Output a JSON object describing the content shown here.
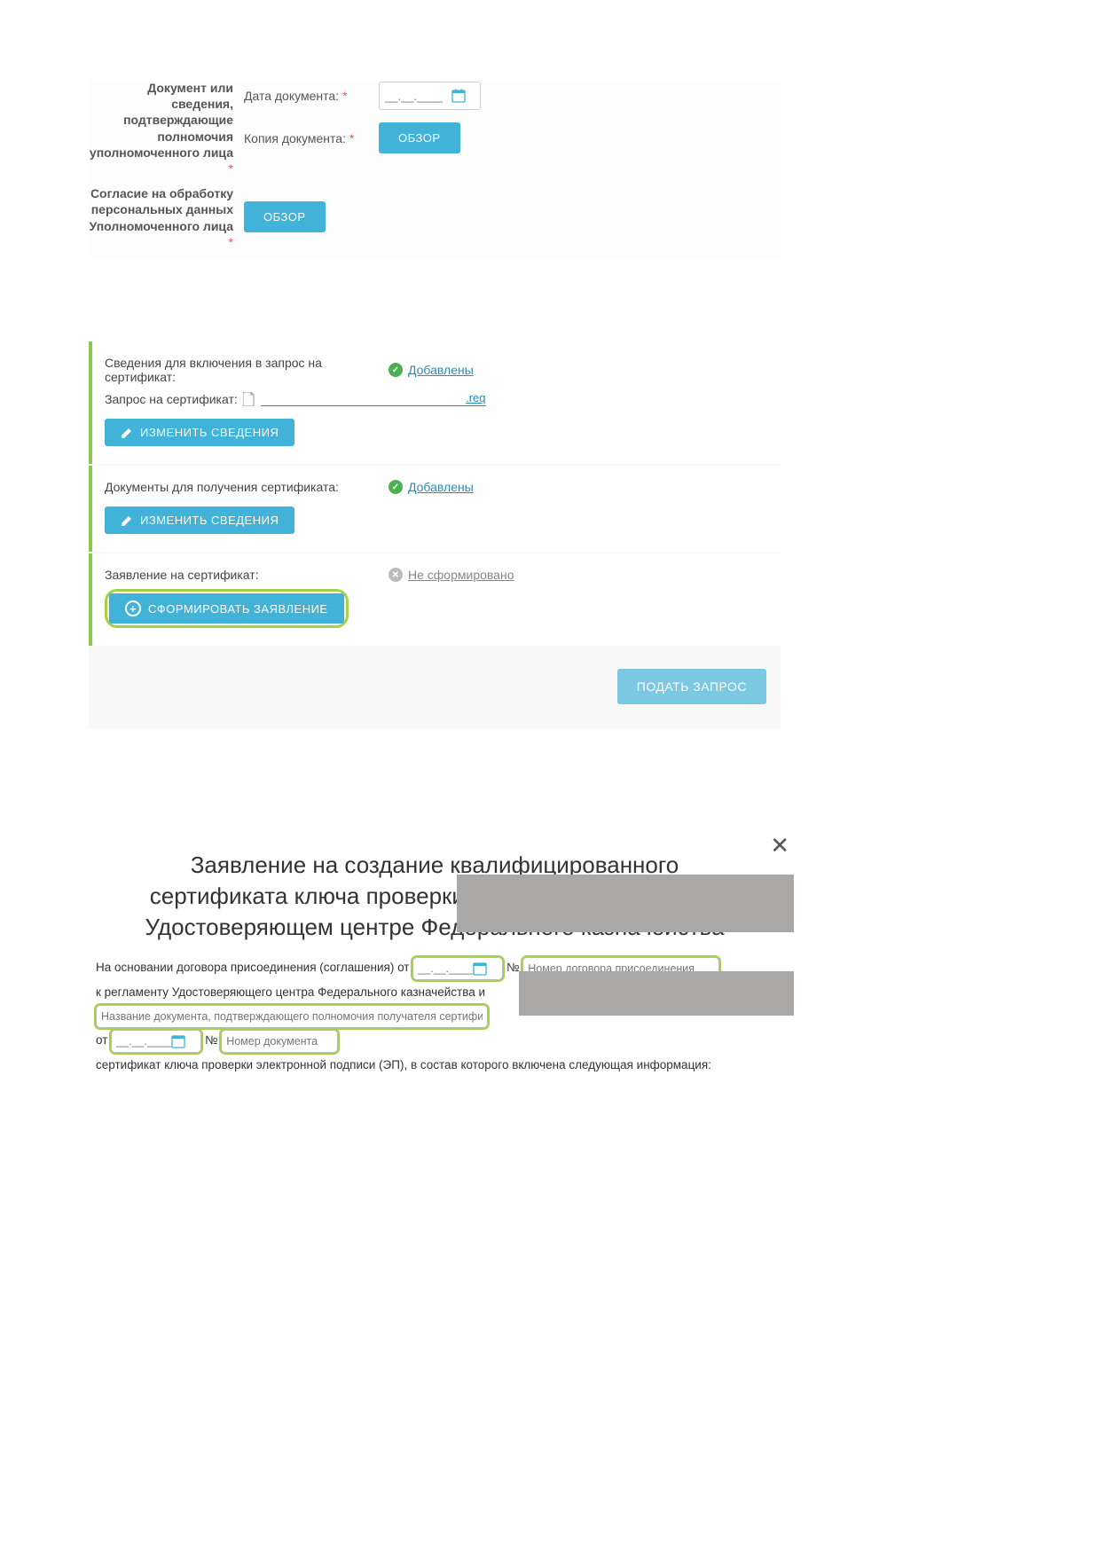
{
  "section1": {
    "row1_label": "Документ или сведения, подтверждающие полномочия уполномоченного лица",
    "date_label": "Дата документа:",
    "date_placeholder": "__.__.____",
    "copy_label": "Копия документа:",
    "browse": "ОБЗОР",
    "row2_label": "Согласие на обработку персональных данных Уполномоченного лица"
  },
  "section2": {
    "card1": {
      "label": "Сведения для включения в запрос на сертификат:",
      "status": "Добавлены",
      "req_label": "Запрос на сертификат:",
      "file_ext": ".req",
      "btn": "ИЗМЕНИТЬ СВЕДЕНИЯ"
    },
    "card2": {
      "label": "Документы для получения сертификата:",
      "status": "Добавлены",
      "btn": "ИЗМЕНИТЬ СВЕДЕНИЯ"
    },
    "card3": {
      "label": "Заявление на сертификат:",
      "status": "Не сформировано",
      "btn": "СФОРМИРОВАТЬ ЗАЯВЛЕНИЕ"
    },
    "submit": "ПОДАТЬ ЗАПРОС"
  },
  "section3": {
    "title": "Заявление на создание квалифицированного сертификата ключа проверки электронной подписи в Удостоверяющем центре Федерального казначейства",
    "line1_a": "На основании договора присоединения (соглашения) от",
    "nn": "№",
    "agree_no_ph": "Номер договора присоединения",
    "line2": "к регламенту Удостоверяющего центра Федерального казначейства и",
    "docname_ph": "Название документа, подтверждающего полномочия получателя сертификата",
    "from": "от",
    "docno_ph": "Номер документа",
    "tail": "сертификат ключа проверки электронной подписи (ЭП), в состав которого включена следующая информация:",
    "date_ph": "__.__.____"
  }
}
